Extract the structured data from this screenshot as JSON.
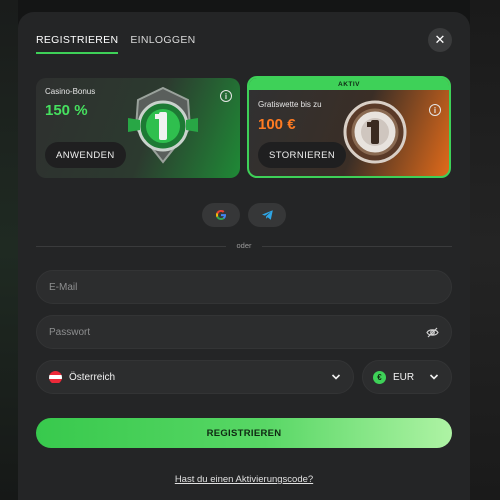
{
  "tabs": [
    {
      "label": "REGISTRIEREN",
      "active": true
    },
    {
      "label": "EINLOGGEN",
      "active": false
    }
  ],
  "close_icon": "close-icon",
  "bonuses": {
    "casino": {
      "title": "Casino-Bonus",
      "amount": "150 %",
      "button_label": "ANWENDEN",
      "accent": "#46e05f"
    },
    "sport": {
      "status": "AKTIV",
      "title": "Gratiswette bis zu",
      "amount": "100 €",
      "button_label": "STORNIEREN",
      "accent": "#ff7b22"
    }
  },
  "social": [
    "google-icon",
    "telegram-icon"
  ],
  "divider_text": "oder",
  "form": {
    "email_placeholder": "E-Mail",
    "password_placeholder": "Passwort",
    "country": "Österreich",
    "currency": "EUR",
    "currency_symbol": "€"
  },
  "register_label": "REGISTRIEREN",
  "activation_link": "Hast du einen Aktivierungscode?",
  "colors": {
    "brand_green": "#3ed158",
    "modal_bg": "#242526"
  }
}
